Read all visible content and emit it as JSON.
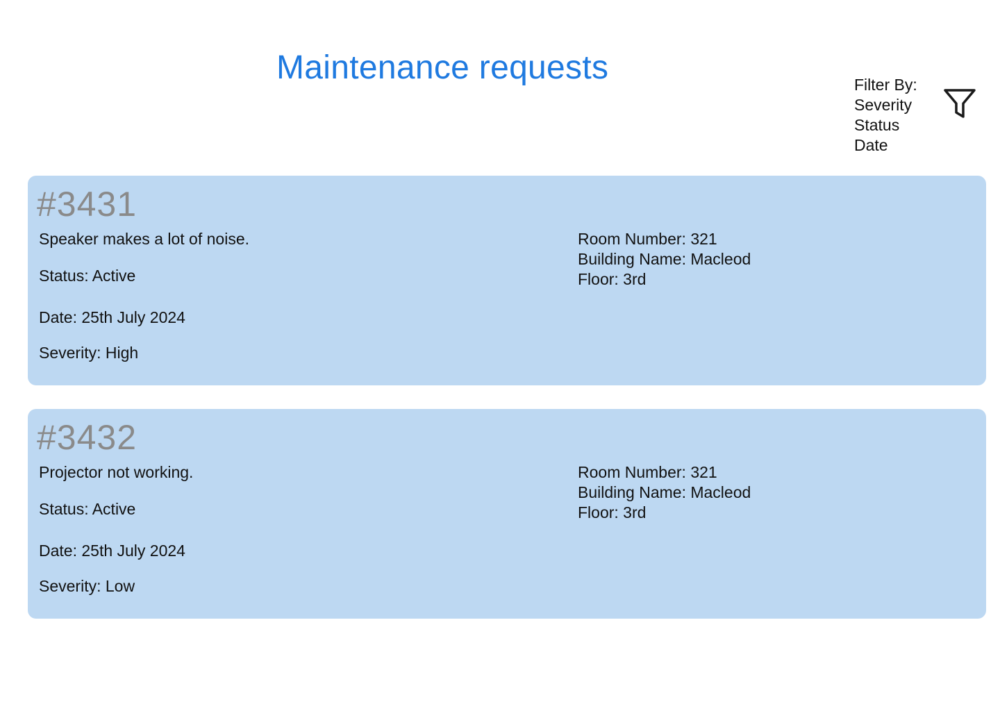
{
  "header": {
    "title": "Maintenance requests"
  },
  "filter": {
    "label": "Filter By:",
    "options": [
      "Severity",
      "Status",
      "Date"
    ],
    "icon": "filter-icon"
  },
  "colors": {
    "title": "#1f7ae0",
    "card_background": "#bdd8f2",
    "request_id": "#8a8a8a"
  },
  "requests": [
    {
      "id": "#3431",
      "description": "Speaker makes a lot of noise.",
      "status": "Status: Active",
      "date": "Date: 25th July 2024",
      "severity": "Severity: High",
      "room": "Room Number: 321",
      "building": "Building Name: Macleod",
      "floor": "Floor: 3rd"
    },
    {
      "id": "#3432",
      "description": "Projector not working.",
      "status": "Status: Active",
      "date": "Date: 25th July 2024",
      "severity": "Severity: Low",
      "room": "Room Number: 321",
      "building": "Building Name: Macleod",
      "floor": "Floor: 3rd"
    }
  ]
}
